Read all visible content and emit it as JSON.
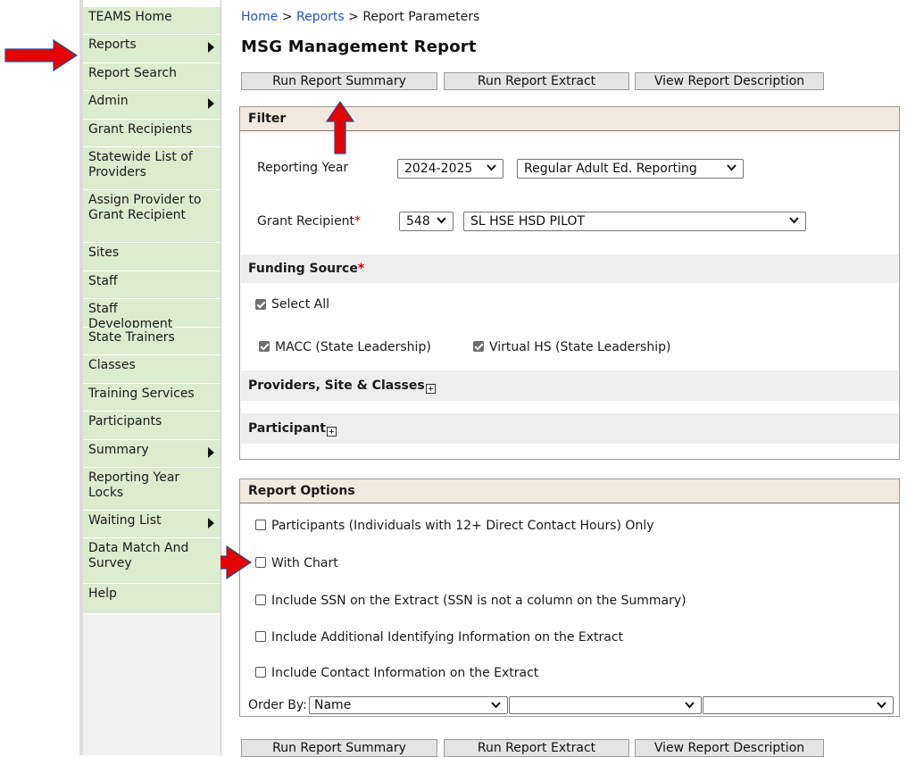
{
  "sidebar": {
    "items": [
      {
        "label": "TEAMS Home",
        "submenu": false
      },
      {
        "label": "Reports",
        "submenu": true
      },
      {
        "label": "Report Search",
        "submenu": false
      },
      {
        "label": "Admin",
        "submenu": true
      },
      {
        "label": "Grant Recipients",
        "submenu": false
      },
      {
        "label": "Statewide List of Providers",
        "submenu": false
      },
      {
        "label": "Assign Provider to Grant Recipient",
        "submenu": false
      },
      {
        "label": "Sites",
        "submenu": false
      },
      {
        "label": "Staff",
        "submenu": false
      },
      {
        "label": "Staff Development",
        "submenu": false
      },
      {
        "label": "State Trainers",
        "submenu": false
      },
      {
        "label": "Classes",
        "submenu": false
      },
      {
        "label": "Training Services",
        "submenu": false
      },
      {
        "label": "Participants",
        "submenu": false
      },
      {
        "label": "Summary",
        "submenu": true
      },
      {
        "label": "Reporting Year Locks",
        "submenu": false
      },
      {
        "label": "Waiting List",
        "submenu": true
      },
      {
        "label": "Data Match And Survey",
        "submenu": false
      },
      {
        "label": "Help",
        "submenu": false
      }
    ]
  },
  "breadcrumb": {
    "home": "Home",
    "sep1": " > ",
    "reports": "Reports",
    "sep2": " > ",
    "current": "Report Parameters"
  },
  "page": {
    "title": "MSG Management Report"
  },
  "buttons": {
    "run_summary": "Run Report Summary",
    "run_extract": "Run Report Extract",
    "view_description": "View Report Description"
  },
  "filter": {
    "header": "Filter",
    "reporting_year_label": "Reporting Year",
    "reporting_year_value": "2024-2025",
    "reporting_type_value": "Regular Adult Ed. Reporting",
    "grant_recipient_label": "Grant Recipient",
    "required_mark": "*",
    "grant_recipient_id": "548",
    "grant_recipient_name": "SL HSE HSD PILOT"
  },
  "funding": {
    "header": "Funding Source",
    "required_mark": "*",
    "select_all": "Select All",
    "select_all_checked": true,
    "options": [
      {
        "label": "MACC (State Leadership)",
        "checked": true
      },
      {
        "label": "Virtual HS (State Leadership)",
        "checked": true
      }
    ]
  },
  "sections": {
    "providers": "Providers, Site & Classes",
    "participant": "Participant"
  },
  "report_options": {
    "header": "Report Options",
    "options": [
      {
        "label": "Participants (Individuals with 12+ Direct Contact Hours) Only",
        "checked": false
      },
      {
        "label": "With Chart",
        "checked": false
      },
      {
        "label": "Include SSN on the Extract (SSN is not a column on the Summary)",
        "checked": false
      },
      {
        "label": "Include Additional Identifying Information on the Extract",
        "checked": false
      },
      {
        "label": "Include Contact Information on the Extract",
        "checked": false
      }
    ],
    "order_by_label": "Order By:",
    "order_by_values": [
      "Name",
      "",
      ""
    ]
  },
  "icons": {
    "caret": "caret-right-icon",
    "chevron": "chevron-down-icon",
    "expand": "expand-plus-icon",
    "annotation_arrow": "red-arrow-icon"
  },
  "colors": {
    "sidebar_bg": "#dbeccf",
    "panel_header_bg": "#f3eadf",
    "link": "#2255c4",
    "required": "#cc0000",
    "annotation_arrow": "#e60000"
  }
}
